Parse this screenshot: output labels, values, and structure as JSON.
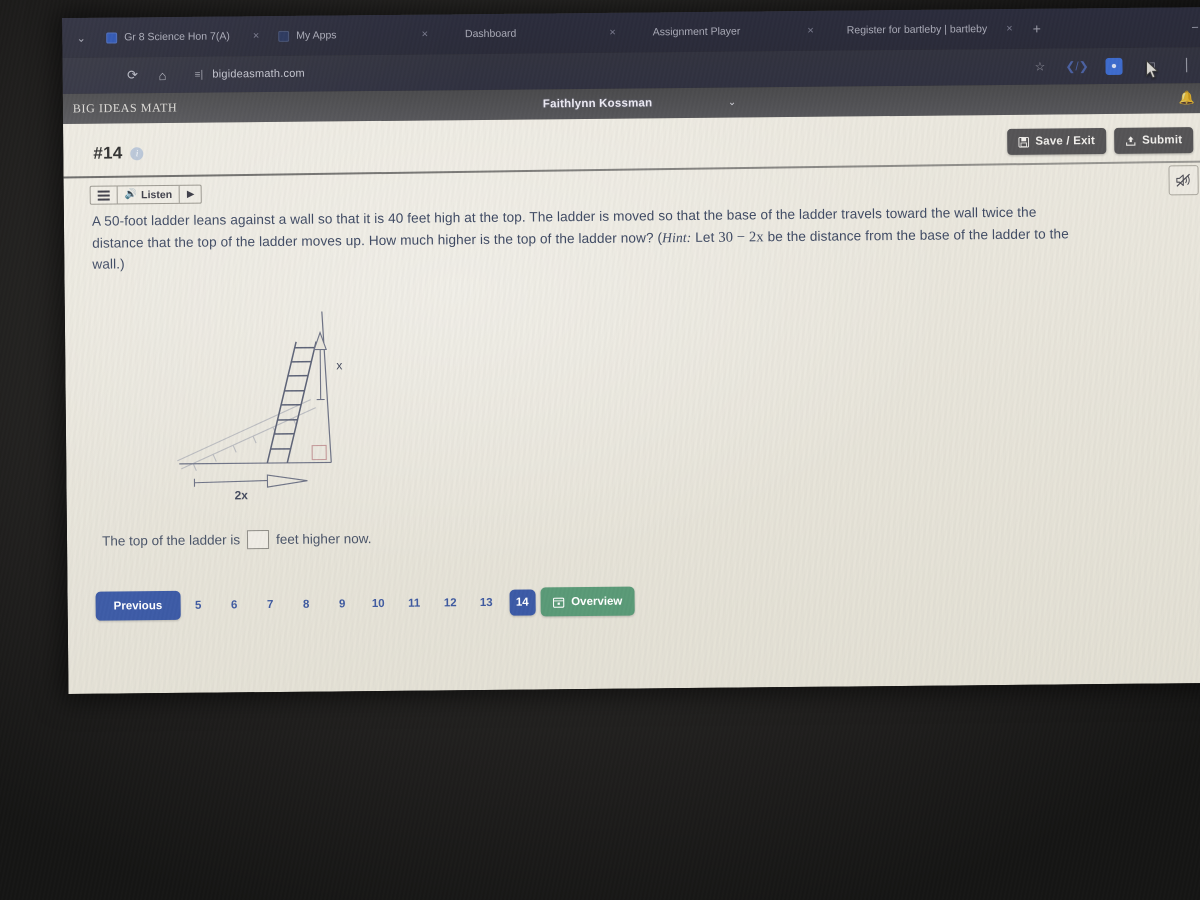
{
  "browser": {
    "tabs": [
      {
        "title": "Gr 8 Science Hon 7(A)",
        "favicon": "science-favicon",
        "close": "×"
      },
      {
        "title": "My Apps",
        "favicon": "myapps-favicon",
        "close": "×"
      },
      {
        "title": "Dashboard",
        "favicon": "none",
        "close": "×"
      },
      {
        "title": "Assignment Player",
        "favicon": "none",
        "close": "×"
      },
      {
        "title": "Register for bartleby | bartleby",
        "favicon": "none",
        "close": "×"
      }
    ],
    "new_tab_label": "+",
    "tab_list_caret": "⌄",
    "reload_icon": "⟳",
    "home_icon": "⌂",
    "tune_icon": "site-settings-icon",
    "address": "bigideasmath.com",
    "toolbar_icons": [
      "bookmark-star-icon",
      "extension-icon",
      "profile-avatar-icon",
      "share-icon",
      "menu-icon"
    ]
  },
  "app": {
    "logo": "BIG IDEAS MATH",
    "user": "Faithlynn Kossman",
    "user_caret": "⌄",
    "notifications_icon": "bell-icon"
  },
  "question": {
    "number": "#14",
    "info_icon": "i",
    "listen": {
      "menu_icon": "lines-icon",
      "speaker_icon": "🔊",
      "label": "Listen",
      "play_icon": "▶"
    },
    "mute_icon": "speaker-muted-icon",
    "text_part1": "A 50-foot ladder leans against a wall so that it is 40 feet high at the top. The ladder is moved so that the base of the ladder travels toward the wall twice the distance that the top of the ladder moves up. How much higher is the top of the ladder now? (",
    "hint_label": "Hint:",
    "text_part2": " Let ",
    "hint_expression": "30 − 2x",
    "text_part3": " be the distance from the base of the ladder to the wall.)",
    "diagram": {
      "vertical_label": "x",
      "horizontal_label": "2x",
      "alt": "ladder-against-wall-diagram"
    },
    "answer_prefix": "The top of the ladder is",
    "answer_value": "",
    "answer_suffix": "feet higher now."
  },
  "header_buttons": {
    "save_exit_label": "Save / Exit",
    "save_exit_icon": "save-disk-icon",
    "submit_label": "Submit",
    "submit_icon": "upload-icon"
  },
  "pager": {
    "previous_label": "Previous",
    "numbers": [
      "5",
      "6",
      "7",
      "8",
      "9",
      "10",
      "11",
      "12",
      "13"
    ],
    "current": "14",
    "overview_label": "Overview",
    "overview_icon": "calendar-icon"
  },
  "colors": {
    "accent_blue": "#3c5aa6",
    "accent_green": "#5a9a77",
    "header_gray": "#555456",
    "page_bg": "#eeebe2",
    "text_blue": "#3f4a63"
  }
}
